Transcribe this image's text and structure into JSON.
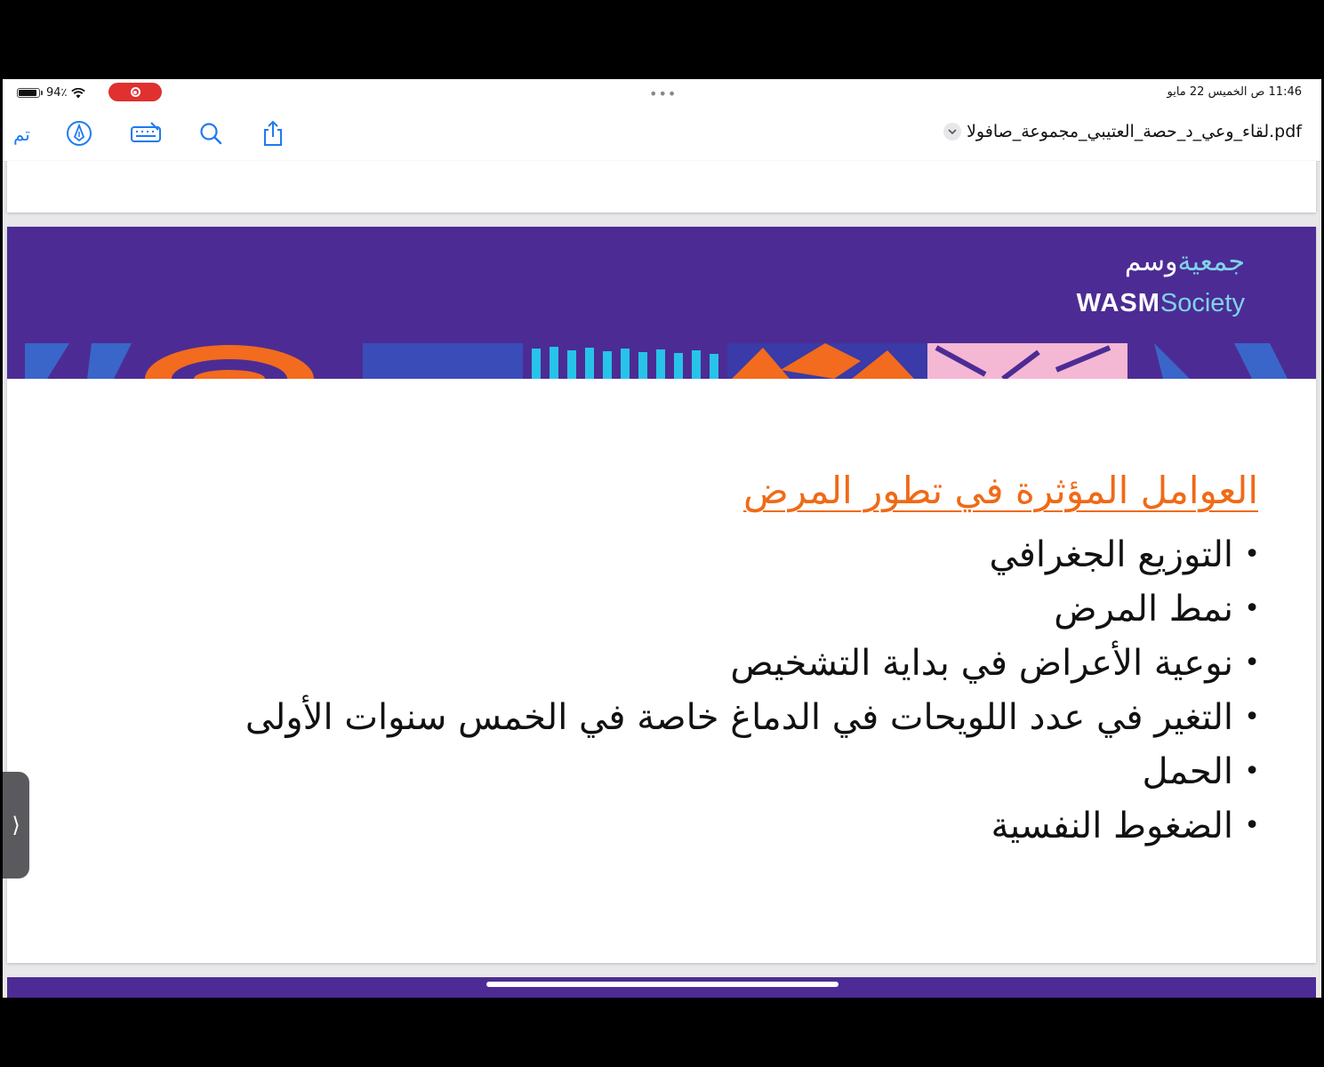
{
  "status_bar": {
    "battery_pct": "94٪",
    "battery_level": 0.94,
    "time_date": "11:46 ص   الخميس 22 مايو",
    "more_dots": "•••"
  },
  "toolbar": {
    "done_label": "تم",
    "filename": "لقاء_وعي_د_حصة_العتيبي_مجموعة_صافولا.pdf",
    "icons": [
      "markup-icon",
      "keyboard-icon",
      "search-icon",
      "share-icon",
      "chevron-down-icon"
    ]
  },
  "slide": {
    "logo_ar_main": "وسم",
    "logo_ar_prefix": "جمعية",
    "logo_en_main": "WASM",
    "logo_en_suffix": "Society",
    "heading": "العوامل المؤثرة في تطور المرض",
    "bullets": [
      "التوزيع الجغرافي",
      "نمط المرض",
      "نوعية الأعراض في بداية التشخيص",
      "التغير في عدد اللويحات في الدماغ خاصة في الخمس سنوات الأولى",
      "الحمل",
      "الضغوط النفسية"
    ]
  },
  "side_handle": {
    "glyph": "⟩"
  },
  "colors": {
    "banner": "#4c2c94",
    "heading": "#ef6a17",
    "accent_blue": "#1f7af0",
    "logo_cyan": "#7fd3ea"
  }
}
